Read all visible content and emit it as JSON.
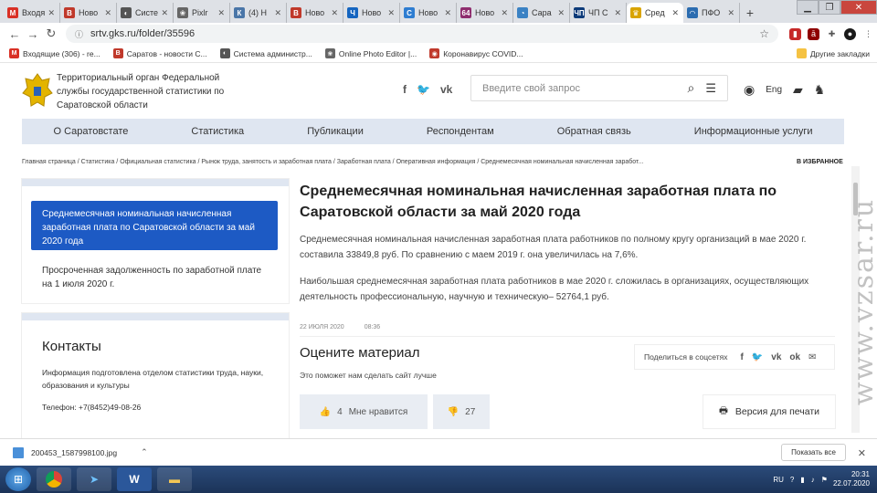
{
  "browser": {
    "tabs": [
      {
        "label": "Входя",
        "icon": "gmail-icon",
        "color": "#d93025",
        "glyph": "M"
      },
      {
        "label": "Ново",
        "icon": "news-b-icon",
        "color": "#c0392b",
        "glyph": "B"
      },
      {
        "label": "Систе",
        "icon": "system-icon",
        "color": "#555555",
        "glyph": "◐"
      },
      {
        "label": "Pixlr",
        "icon": "pixlr-icon",
        "color": "#666666",
        "glyph": "❀"
      },
      {
        "label": "(4) Н",
        "icon": "vk-icon",
        "color": "#4a76a8",
        "glyph": "К"
      },
      {
        "label": "Ново",
        "icon": "news-b-icon",
        "color": "#c0392b",
        "glyph": "B"
      },
      {
        "label": "Ново",
        "icon": "news-ch-icon",
        "color": "#1565c0",
        "glyph": "Ч"
      },
      {
        "label": "Ново",
        "icon": "news-c-icon",
        "color": "#2e7dd1",
        "glyph": "C"
      },
      {
        "label": "Ново",
        "icon": "news-64-icon",
        "color": "#8e2d6e",
        "glyph": "64"
      },
      {
        "label": "Сара",
        "icon": "sara-icon",
        "color": "#3b82c4",
        "glyph": "◔"
      },
      {
        "label": "ЧП С",
        "icon": "chp-icon",
        "color": "#0d3b7a",
        "glyph": "ЧП"
      },
      {
        "label": "Сред",
        "icon": "rosstat-icon",
        "color": "#d9a400",
        "glyph": "♛"
      },
      {
        "label": "ПФО",
        "icon": "pfo-icon",
        "color": "#2b6cb0",
        "glyph": "◠"
      }
    ],
    "active_tab": 11,
    "url": "srtv.gks.ru/folder/35596",
    "bookmarks": [
      {
        "label": "Входящие (306) - re...",
        "color": "#d93025",
        "glyph": "M"
      },
      {
        "label": "Саратов - новости С...",
        "color": "#c0392b",
        "glyph": "B"
      },
      {
        "label": "Система администр...",
        "color": "#555555",
        "glyph": "◐"
      },
      {
        "label": "Online Photo Editor |...",
        "color": "#666666",
        "glyph": "❀"
      },
      {
        "label": "Коронавирус COVID...",
        "color": "#c0392b",
        "glyph": "◉"
      }
    ],
    "other_bookmarks": "Другие закладки"
  },
  "site": {
    "org_name": "Территориальный орган Федеральной службы государственной статистики по Саратовской области",
    "search_placeholder": "Введите свой запрос",
    "lang": "Eng",
    "menu": [
      "О Саратовстате",
      "Статистика",
      "Публикации",
      "Респондентам",
      "Обратная связь",
      "Информационные услуги"
    ],
    "breadcrumbs": "Главная страница / Статистика / Официальная статистика / Рынок труда, занятость и заработная плата / Заработная плата / Оперативная информация / Среднемесячная номинальная начисленная заработ...",
    "favorites": "В ИЗБРАННОЕ"
  },
  "sidebar": {
    "active_item": "Среднемесячная номинальная начисленная заработная плата по Саратовской области за май 2020 года",
    "item2": "Просроченная задолженность по заработной плате на 1 июля 2020 г.",
    "contacts_title": "Контакты",
    "contacts_info": "Информация подготовлена отделом статистики труда, науки, образования и культуры",
    "phone": "Телефон: +7(8452)49-08-26"
  },
  "article": {
    "title": "Среднемесячная номинальная начисленная заработная плата по Саратовской области за май 2020 года",
    "p1": "Среднемесячная номинальная начисленная заработная плата работников по полному кругу организаций в мае 2020 г. составила 33849,8 руб. По сравнению с маем 2019 г. она увеличилась на 7,6%.",
    "p2": "Наибольшая среднемесячная заработная плата работников в мае 2020 г. сложилась в организациях, осуществляющих деятельность профессиональную, научную и техническую– 52764,1 руб.",
    "date": "22 ИЮЛЯ 2020",
    "time": "08:36",
    "rate_title": "Оцените материал",
    "rate_sub": "Это поможет нам сделать сайт лучше",
    "share_label": "Поделиться в соцсетях",
    "likes": "4",
    "like_label": "Мне нравится",
    "dislikes": "27",
    "print_label": "Версия для печати"
  },
  "watermark": "www.vzsar.ru",
  "download": {
    "file": "200453_1587998100.jpg",
    "show_all": "Показать все"
  },
  "taskbar": {
    "lang": "RU",
    "time": "20:31",
    "date": "22.07.2020"
  }
}
